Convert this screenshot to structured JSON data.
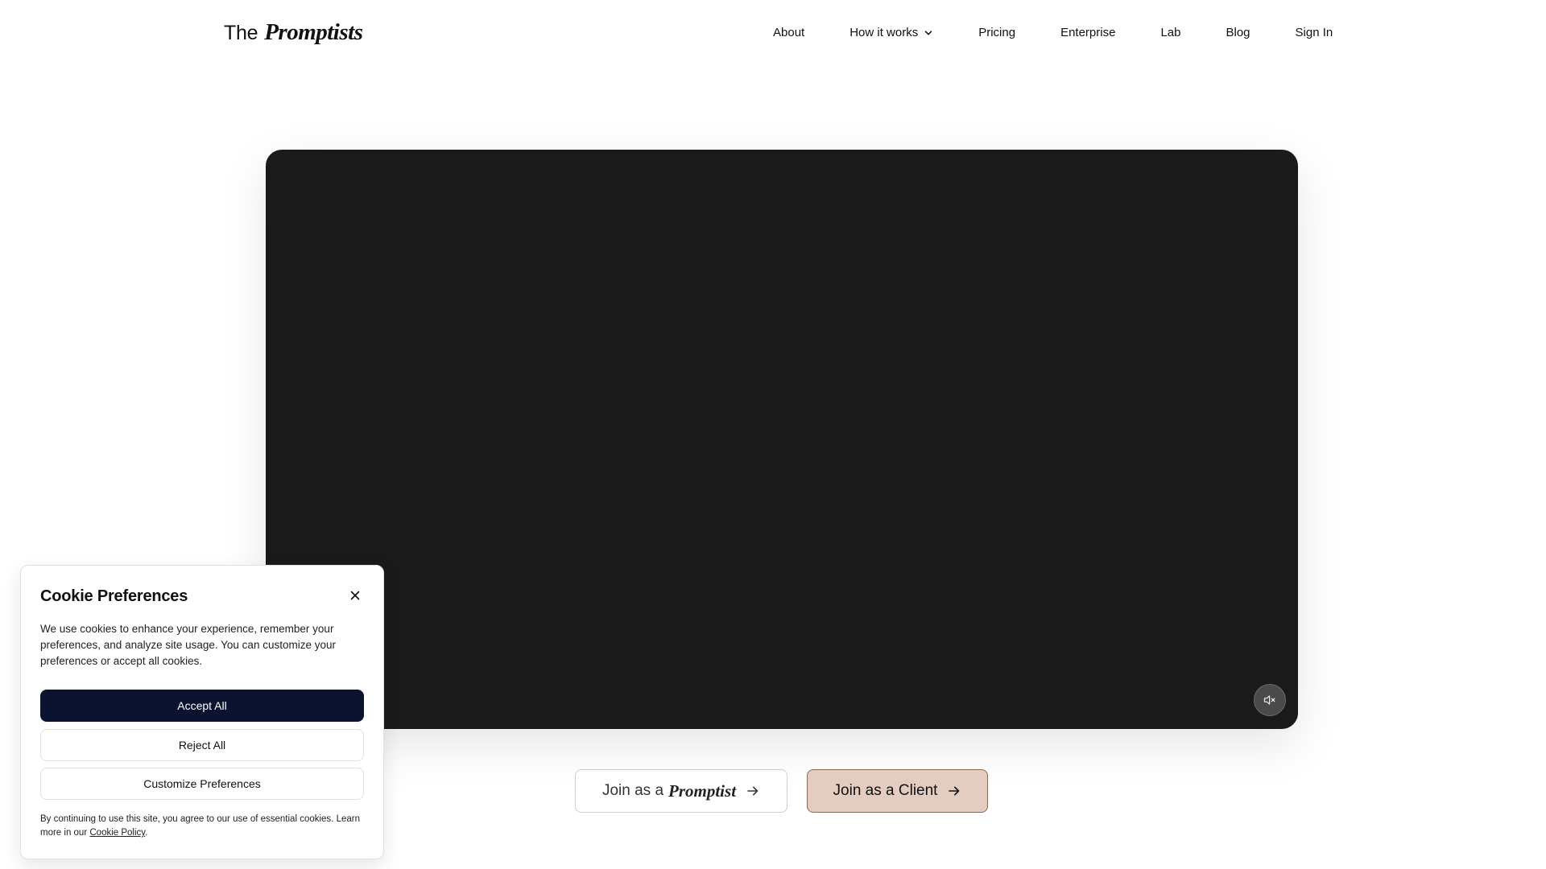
{
  "header": {
    "logo_the": "The",
    "logo_name": "Promptists",
    "nav": {
      "about": "About",
      "how_it_works": "How it works",
      "pricing": "Pricing",
      "enterprise": "Enterprise",
      "lab": "Lab",
      "blog": "Blog",
      "sign_in": "Sign In"
    }
  },
  "video": {
    "mute_icon": "speaker-muted-icon"
  },
  "cta": {
    "promptist_prefix": "Join as a",
    "promptist_brand": "Promptist",
    "client_label": "Join as a Client"
  },
  "cookie": {
    "title": "Cookie Preferences",
    "description": "We use cookies to enhance your experience, remember your preferences, and analyze site usage. You can customize your preferences or accept all cookies.",
    "accept_label": "Accept All",
    "reject_label": "Reject All",
    "customize_label": "Customize Preferences",
    "footer_text": "By continuing to use this site, you agree to our use of essential cookies. Learn more in our",
    "policy_link": "Cookie Policy",
    "footer_end": "."
  },
  "colors": {
    "accent_dark": "#0c1330",
    "client_button": "#e2cdc0",
    "video_bg": "#1a1a1a"
  }
}
